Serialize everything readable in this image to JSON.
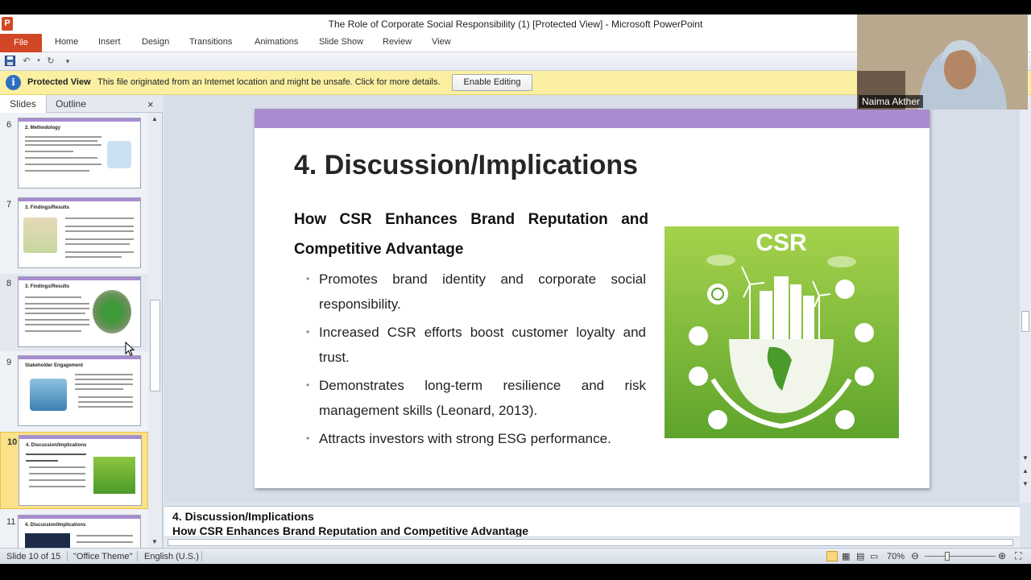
{
  "window": {
    "title": "The Role of Corporate Social Responsibility (1) [Protected View]  -  Microsoft PowerPoint"
  },
  "ribbon": {
    "file": "File",
    "tabs": [
      "Home",
      "Insert",
      "Design",
      "Transitions",
      "Animations",
      "Slide Show",
      "Review",
      "View"
    ]
  },
  "protected_view": {
    "title": "Protected View",
    "message": "This file originated from an Internet location and might be unsafe. Click for more details.",
    "button": "Enable Editing"
  },
  "pane": {
    "tab_slides": "Slides",
    "tab_outline": "Outline",
    "close": "×"
  },
  "thumbnails": [
    {
      "num": "6",
      "title": "2. Methodology"
    },
    {
      "num": "7",
      "title": "3. Findings/Results"
    },
    {
      "num": "8",
      "title": "3. Findings/Results"
    },
    {
      "num": "9",
      "title": "Stakeholder Engagement"
    },
    {
      "num": "10",
      "title": "4. Discussion/Implications"
    },
    {
      "num": "11",
      "title": "4. Discussion/Implications"
    }
  ],
  "slide": {
    "title": "4. Discussion/Implications",
    "subtitle": "How CSR Enhances Brand Reputation and Competitive Advantage",
    "bullets": [
      "Promotes brand identity and corporate social responsibility.",
      "Increased CSR efforts boost customer loyalty and trust.",
      "Demonstrates long-term resilience and risk management skills (Leonard, 2013).",
      "Attracts investors with strong ESG performance."
    ],
    "image_text": "CSR",
    "accent_color": "#a98cd0"
  },
  "notes": {
    "line1": "4. Discussion/Implications",
    "line2": "How CSR Enhances Brand Reputation and Competitive Advantage"
  },
  "status": {
    "slide": "Slide 10 of 15",
    "theme": "\"Office Theme\"",
    "language": "English (U.S.)",
    "zoom": "70%"
  },
  "webcam": {
    "name": "Naima Akther"
  }
}
